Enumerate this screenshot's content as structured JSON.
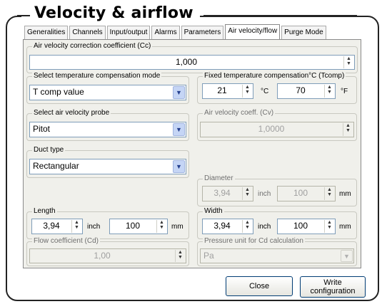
{
  "title": "Velocity & airflow",
  "tabs": [
    "Generalities",
    "Channels",
    "Input/output",
    "Alarms",
    "Parameters",
    "Air velocity/flow",
    "Purge Mode"
  ],
  "cc": {
    "label": "Air velocity correction coefficient (Cc)",
    "value": "1,000"
  },
  "temp_mode": {
    "label": "Select temperature compensation mode",
    "value": "T comp value"
  },
  "tcomp": {
    "label": "Fixed temperature compensation°C (Tcomp)",
    "celsius": "21",
    "celsius_unit": "°C",
    "fahrenheit": "70",
    "fahrenheit_unit": "°F"
  },
  "probe": {
    "label": "Select air velocity probe",
    "value": "Pitot"
  },
  "cv": {
    "label": "Air velocity coeff. (Cv)",
    "value": "1,0000"
  },
  "duct": {
    "label": "Duct type",
    "value": "Rectangular"
  },
  "diameter": {
    "label": "Diameter",
    "inch": "3,94",
    "inch_unit": "inch",
    "mm": "100",
    "mm_unit": "mm"
  },
  "length": {
    "label": "Length",
    "inch": "3,94",
    "inch_unit": "inch",
    "mm": "100",
    "mm_unit": "mm"
  },
  "width": {
    "label": "Width",
    "inch": "3,94",
    "inch_unit": "inch",
    "mm": "100",
    "mm_unit": "mm"
  },
  "cd": {
    "label": "Flow coefficient (Cd)",
    "value": "1,00"
  },
  "pressure_unit": {
    "label": "Pressure unit for Cd calculation",
    "value": "Pa"
  },
  "buttons": {
    "close": "Close",
    "write_line1": "Write",
    "write_line2": "configuration"
  }
}
